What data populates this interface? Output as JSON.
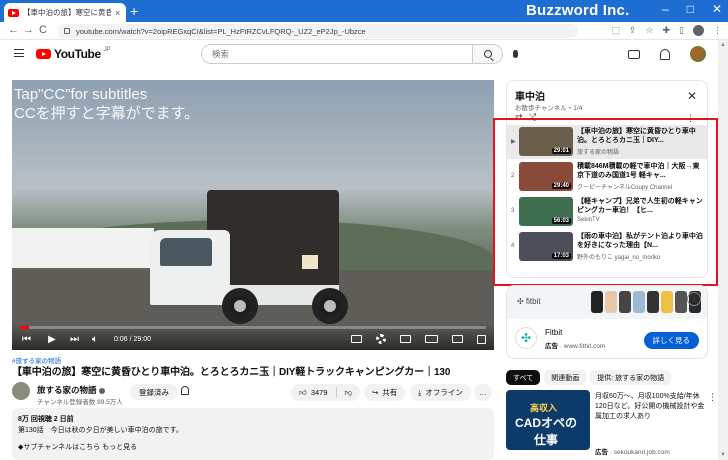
{
  "browser": {
    "tab_title": "【車中泊の旅】寒空に黄昏ひとり車中...",
    "tab_close": "×",
    "new_tab": "+",
    "brand": "Buzzword Inc.",
    "window_controls": [
      "–",
      "□",
      "✕"
    ],
    "nav": {
      "back": "←",
      "forward": "→",
      "reload": "C"
    },
    "url": "youtube.com/watch?v=2oipREGxqCI&list=PL_HzFtRZCvLFQRQ-_UZ2_eP2Jp_-Ubzce"
  },
  "youtube": {
    "logo_word": "YouTube",
    "logo_jp": "JP",
    "search_placeholder": "検索"
  },
  "player": {
    "cc_line1": "Tap\"CC\"for subtitles",
    "cc_line2": "CCを押すと字幕がでます。",
    "progress_fraction": 0.02,
    "time": "0:06 / 29:00"
  },
  "video": {
    "hashtag": "#旅する家の物語",
    "title": "【車中泊の旅】寒空に黄昏ひとり車中泊。とろとろカニ玉｜DIY軽トラックキャンピングカー｜130",
    "channel_name": "旅する家の物語",
    "channel_subs": "チャンネル登録者数 89.5万人",
    "subscribe_label": "登録済み",
    "likes": "3479",
    "share_label": "共有",
    "offline_label": "オフライン",
    "more_label": "…",
    "description_meta": "8万 回視聴 2 日前",
    "description_line1": "第130話　今日は秋の夕日が美しい車中泊の旅です。",
    "description_line2": "◆サブチャンネルはこちら もっと見る"
  },
  "playlist": {
    "title": "車中泊",
    "subtitle": "お散歩チャンネル・1/4",
    "close": "✕",
    "controls": "⇄ ⤮",
    "more": "⋮",
    "items": [
      {
        "index": "▶",
        "title": "【車中泊の旅】寒空に黄昏ひとり車中泊。とろとろカニ玉｜DIY...",
        "channel": "旅する家の物語",
        "duration": "29:01",
        "thumb_color": "#6b5f4c",
        "active": true
      },
      {
        "index": "2",
        "title": "積載846M積載の軽で車中泊｜大阪→東京下道のみ国道1号 軽キャ...",
        "channel": "クーピーチャンネルCoupy Channel",
        "duration": "29:40",
        "thumb_color": "#8a4a3a",
        "active": false
      },
      {
        "index": "3",
        "title": "【軽キャンプ】兄弟で人生初の軽キャンピングカー車泊！【ヒ...",
        "channel": "SekinTV",
        "duration": "56:03",
        "thumb_color": "#3f6f4f",
        "active": false
      },
      {
        "index": "4",
        "title": "【雨の車中泊】私がテント泊より車中泊を好きになった理由【N...",
        "channel": "野外のもりこ yagai_no_moriko",
        "duration": "17:03",
        "thumb_color": "#4c4f59",
        "active": false
      }
    ]
  },
  "ad": {
    "banner_logo": "✣ fitbit",
    "info": "i",
    "name": "Fitbit",
    "sponsor_label": "広告",
    "domain": "www.fitbit.com",
    "button": "詳しく見る",
    "watch_colors": [
      "#222",
      "#e8c8a8",
      "#444",
      "#9dbad4",
      "#333",
      "#f0c040",
      "#555",
      "#2a2a2a"
    ]
  },
  "chips": [
    "すべて",
    "関連動画",
    "提供: 旅する家の物語"
  ],
  "recommended": {
    "thumb_line1": "高収入",
    "thumb_line2": "CADオペの",
    "thumb_line3": "仕事",
    "title": "月収60万～、月収100%支給/年休120日など。好公開の機械設計や金属加工の求人あり",
    "ad_label": "広告",
    "domain": "sekoukanri.job.com",
    "more": "⋮"
  }
}
